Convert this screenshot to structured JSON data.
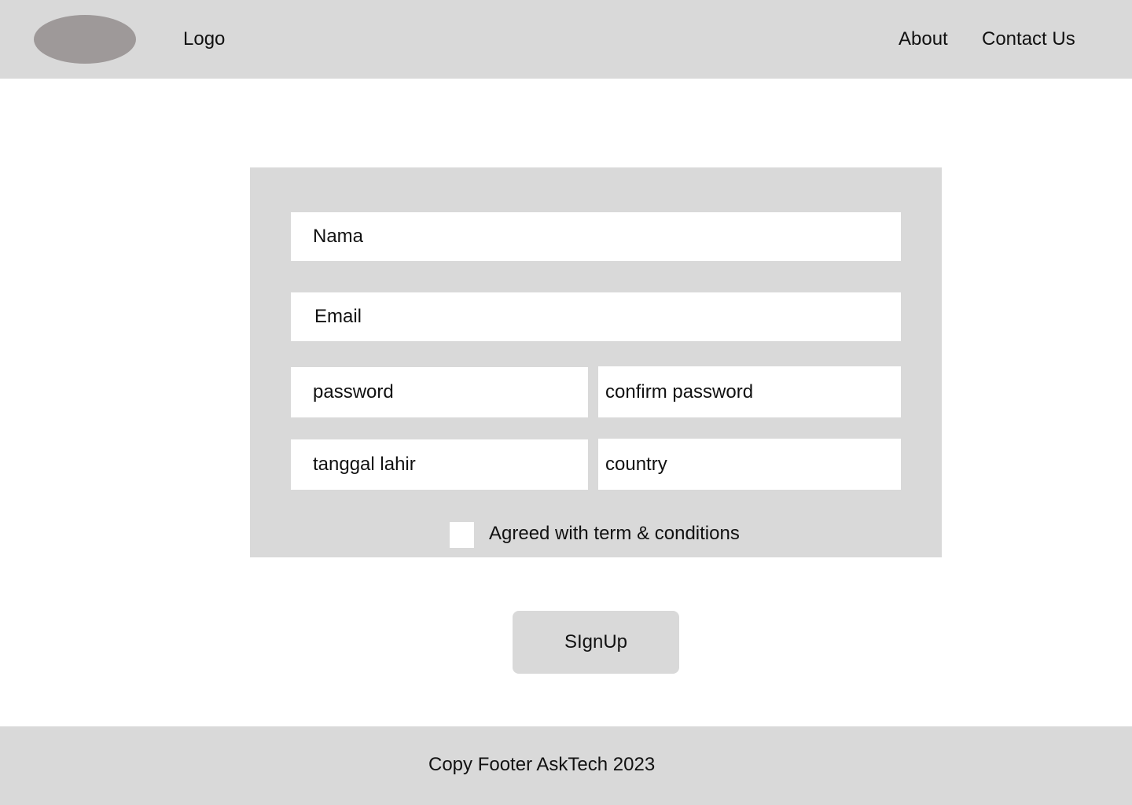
{
  "header": {
    "logo_text": "Logo",
    "nav": {
      "about": "About",
      "contact": "Contact Us"
    }
  },
  "form": {
    "fields": {
      "nama": "Nama",
      "email": "Email",
      "password": "password",
      "confirm_password": "confirm password",
      "tanggal_lahir": "tanggal lahir",
      "country": "country"
    },
    "terms_label": "Agreed with term & conditions",
    "submit_label": "SIgnUp"
  },
  "footer": {
    "text": "Copy Footer AskTech 2023"
  },
  "colors": {
    "panel_gray": "#d9d9d9",
    "logo_gray": "#9e9999",
    "field_white": "#ffffff"
  }
}
